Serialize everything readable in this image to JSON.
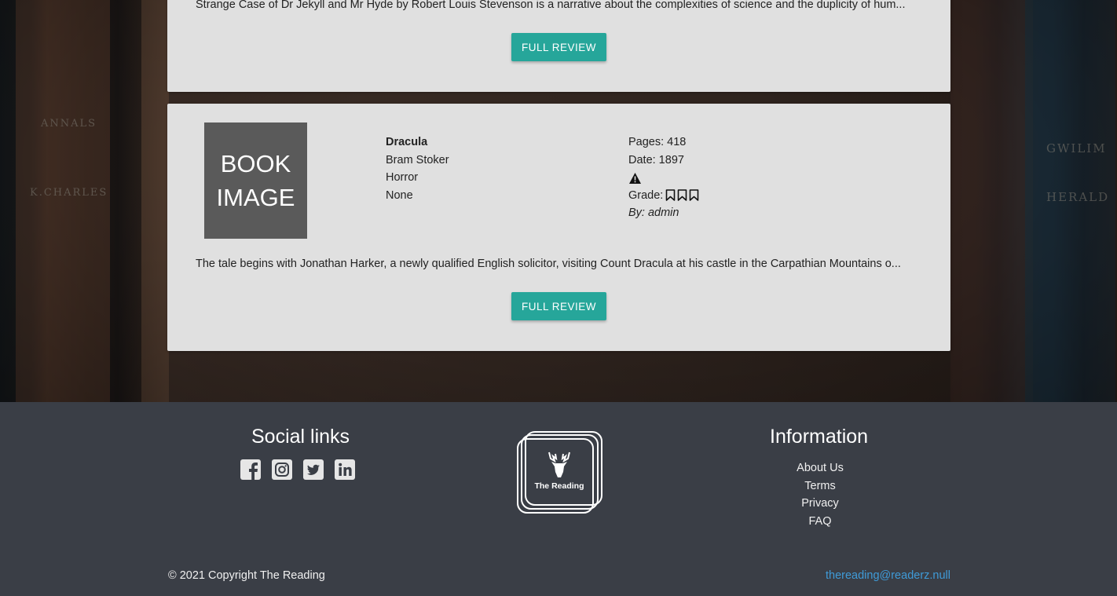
{
  "cards": [
    {
      "excerpt": "Strange Case of Dr Jekyll and Mr Hyde by Robert Louis Stevenson is a narrative about the complexities of science and the duplicity of hum...",
      "button_label": "FULL REVIEW"
    },
    {
      "image_text_line1": "BOOK",
      "image_text_line2": "IMAGE",
      "title": "Dracula",
      "author": "Bram Stoker",
      "genre": "Horror",
      "extra": "None",
      "pages": "Pages: 418",
      "date": "Date: 1897",
      "warning_icon": "warning-triangle-icon",
      "grade_label": "Grade:",
      "grade_value": 3,
      "grade_icon": "bookmark-icon",
      "by": "By: admin",
      "excerpt": "The tale begins with Jonathan Harker, a newly qualified English solicitor, visiting Count Dracula at his castle in the Carpathian Mountains o...",
      "button_label": "FULL REVIEW"
    }
  ],
  "footer": {
    "social_title": "Social links",
    "social_icons": [
      "facebook-icon",
      "instagram-icon",
      "twitter-icon",
      "linkedin-icon"
    ],
    "logo_text": "The Reading",
    "info_title": "Information",
    "links": [
      "About Us",
      "Terms",
      "Privacy",
      "FAQ"
    ],
    "copyright": "© 2021 Copyright The Reading",
    "email": "thereading@readerz.null"
  },
  "colors": {
    "accent": "#26a69a",
    "card_bg": "#e0e0e0",
    "footer_bg": "#3a3e46",
    "link": "#3f9bd8"
  }
}
